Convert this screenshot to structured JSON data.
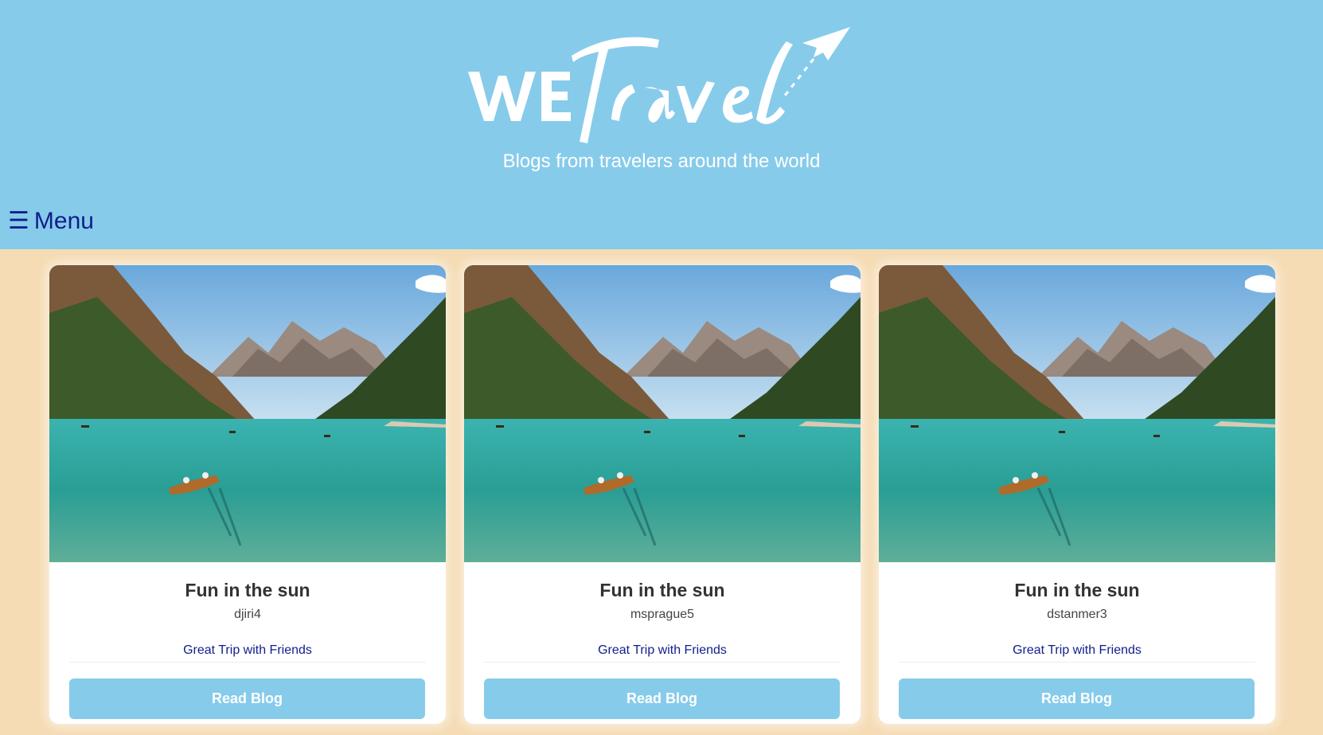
{
  "header": {
    "logo_text": "weTravel",
    "tagline": "Blogs from travelers around the world",
    "menu_icon": "hamburger-icon",
    "menu_icon_glyph": "☰",
    "menu_label": "Menu"
  },
  "colors": {
    "header_bg": "#87cbea",
    "page_bg": "#f5dcb5",
    "button_bg": "#87cbea",
    "link_text": "#101e8c"
  },
  "cards": [
    {
      "title": "Fun in the sun",
      "author": "djiri4",
      "summary": "Great Trip with Friends",
      "button_label": "Read Blog",
      "image": "mountain-lake-rowboat-photo"
    },
    {
      "title": "Fun in the sun",
      "author": "msprague5",
      "summary": "Great Trip with Friends",
      "button_label": "Read Blog",
      "image": "mountain-lake-rowboat-photo"
    },
    {
      "title": "Fun in the sun",
      "author": "dstanmer3",
      "summary": "Great Trip with Friends",
      "button_label": "Read Blog",
      "image": "mountain-lake-rowboat-photo"
    }
  ]
}
